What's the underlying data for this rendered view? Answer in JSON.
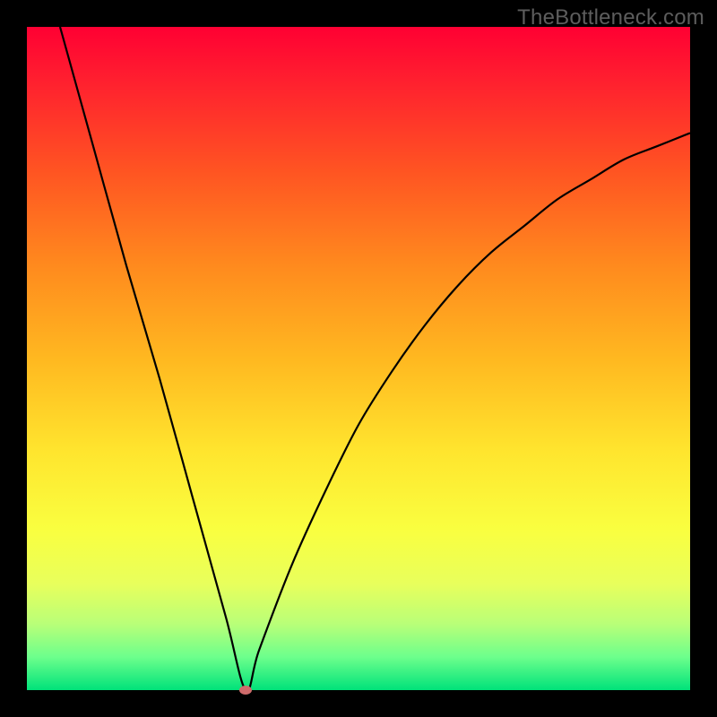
{
  "watermark": "TheBottleneck.com",
  "chart_data": {
    "type": "line",
    "title": "",
    "xlabel": "",
    "ylabel": "",
    "xlim": [
      0,
      100
    ],
    "ylim": [
      0,
      100
    ],
    "background_gradient": {
      "top": "#ff0033",
      "bottom": "#00e27a"
    },
    "series": [
      {
        "name": "bottleneck-curve",
        "x": [
          5,
          10,
          15,
          20,
          25,
          30,
          33,
          35,
          40,
          45,
          50,
          55,
          60,
          65,
          70,
          75,
          80,
          85,
          90,
          95,
          100
        ],
        "y": [
          100,
          82,
          64,
          47,
          29,
          11,
          0,
          6,
          19,
          30,
          40,
          48,
          55,
          61,
          66,
          70,
          74,
          77,
          80,
          82,
          84
        ]
      }
    ],
    "marker": {
      "x": 33,
      "y": 0,
      "color": "#cf6b6b"
    }
  }
}
